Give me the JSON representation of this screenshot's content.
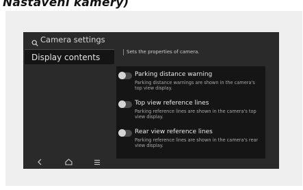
{
  "document": {
    "caption": "Nastavení kamery)"
  },
  "screen": {
    "title": "Camera settings",
    "title_icon": "search-icon"
  },
  "sidebar": {
    "items": [
      {
        "label": "Display contents",
        "selected": true
      }
    ]
  },
  "bottom_nav": {
    "back_icon": "chevron-left-icon",
    "home_icon": "home-icon",
    "menu_icon": "menu-icon"
  },
  "content": {
    "description": "Sets the properties of camera.",
    "options": [
      {
        "title": "Parking distance warning",
        "description": "Parking distance warnings are shown in the camera's top view display.",
        "enabled": false
      },
      {
        "title": "Top view reference lines",
        "description": "Parking reference lines are shown in the camera's top view display.",
        "enabled": false
      },
      {
        "title": "Rear view reference lines",
        "description": "Parking reference lines are shown in the camera's rear view display.",
        "enabled": false
      }
    ]
  },
  "colors": {
    "screen_background": "#2a2a2a",
    "panel_background": "#151515",
    "toggle_off": "#4a4a4a",
    "text_primary": "#ececec",
    "text_secondary": "#a9a9a9"
  }
}
